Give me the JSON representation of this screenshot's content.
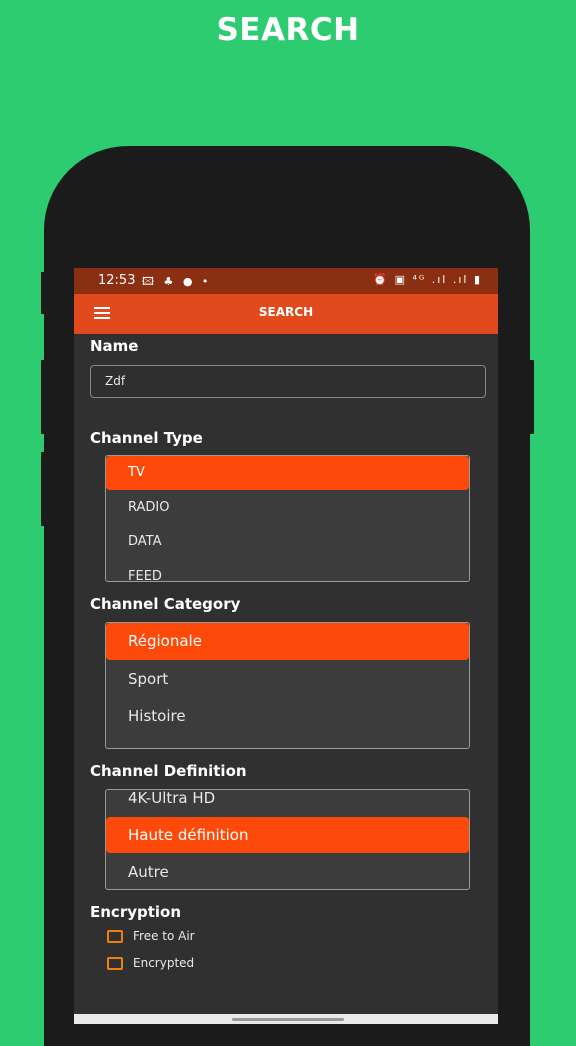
{
  "promo": {
    "title": "SEARCH"
  },
  "status_bar": {
    "time": "12:53",
    "left_icons": "🖾 ♣ ● •",
    "right_icons": "⏰ ▣ ⁴ᴳ .ıl .ıl ▮"
  },
  "app_bar": {
    "title": "SEARCH",
    "menu_icon": "hamburger-menu-icon"
  },
  "name_section": {
    "label": "Name",
    "value": "Zdf"
  },
  "channel_type": {
    "label": "Channel Type",
    "options": [
      "TV",
      "RADIO",
      "DATA",
      "FEED"
    ],
    "selected": "TV"
  },
  "channel_category": {
    "label": "Channel Category",
    "options": [
      "Régionale",
      "Sport",
      "Histoire"
    ],
    "selected": "Régionale"
  },
  "channel_definition": {
    "label": "Channel Definition",
    "options": [
      "4K-Ultra HD",
      "Haute définition",
      "Autre"
    ],
    "selected": "Haute définition"
  },
  "encryption": {
    "label": "Encryption",
    "options": [
      "Free to Air",
      "Encrypted"
    ]
  },
  "colors": {
    "background": "#2ecc71",
    "app_bar": "#e04a1c",
    "status_bar": "#8b2f12",
    "selected": "#fd4a0a",
    "checkbox": "#f07f12",
    "screen": "#303030"
  }
}
